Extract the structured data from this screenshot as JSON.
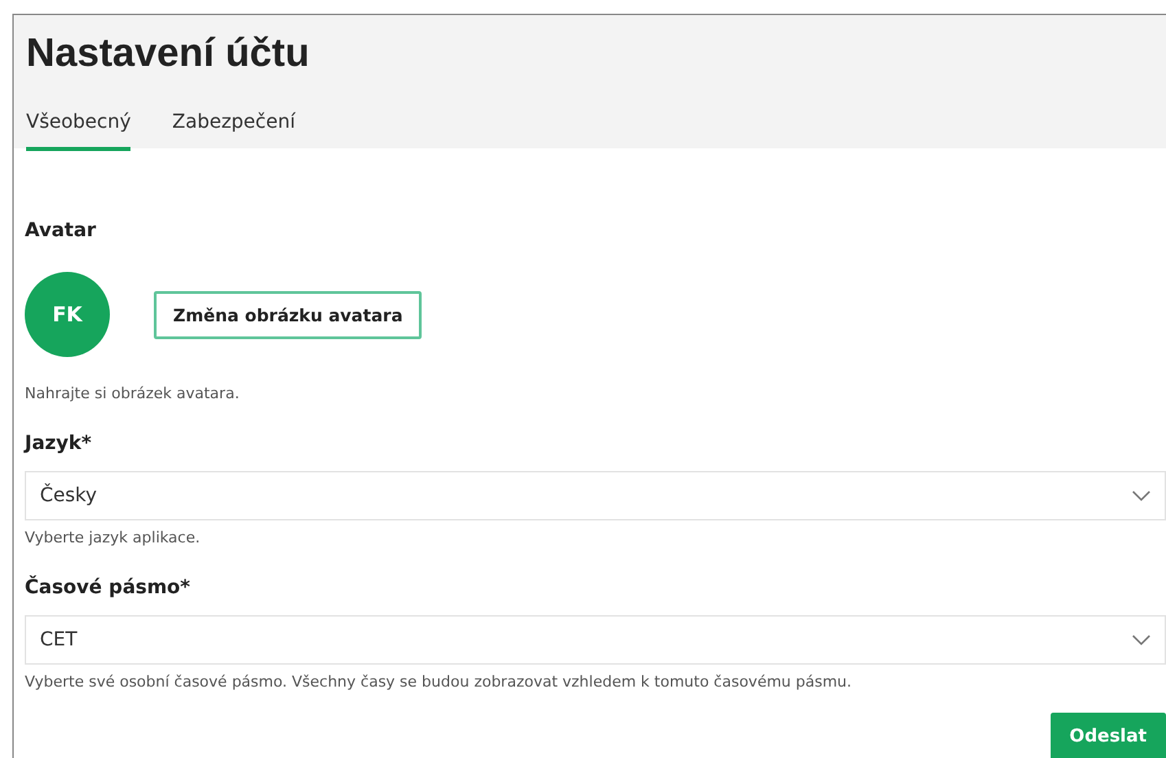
{
  "page": {
    "title": "Nastavení účtu"
  },
  "tabs": [
    {
      "label": "Všeobecný",
      "selected": true
    },
    {
      "label": "Zabezpečení",
      "selected": false
    }
  ],
  "avatar": {
    "label": "Avatar",
    "initials": "FK",
    "change_button": "Změna obrázku avatara",
    "hint": "Nahrajte si obrázek avatara."
  },
  "fields": [
    {
      "label": "Jazyk*",
      "value": "Česky",
      "hint": "Vyberte jazyk aplikace."
    },
    {
      "label": "Časové pásmo*",
      "value": "CET",
      "hint": "Vyberte své osobní časové pásmo. Všechny časy se budou zobrazovat vzhledem k tomuto časovému pásmu."
    }
  ],
  "submit_button": "Odeslat"
}
